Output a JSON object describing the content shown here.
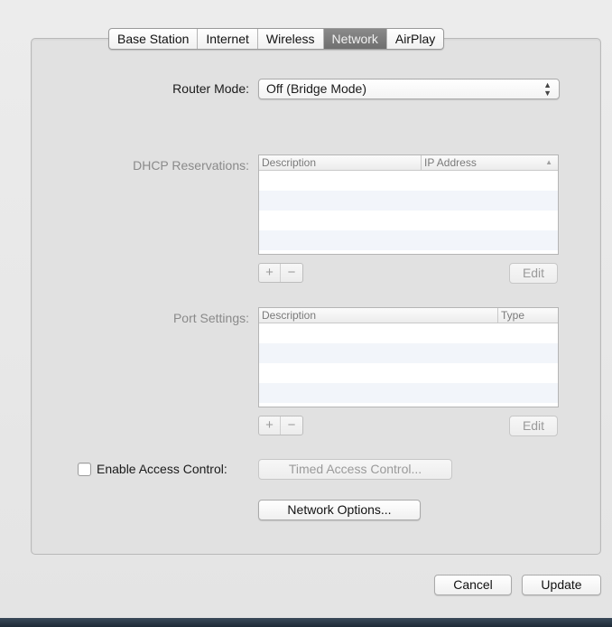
{
  "tabs": [
    {
      "label": "Base Station",
      "selected": false
    },
    {
      "label": "Internet",
      "selected": false
    },
    {
      "label": "Wireless",
      "selected": false
    },
    {
      "label": "Network",
      "selected": true
    },
    {
      "label": "AirPlay",
      "selected": false
    }
  ],
  "router_mode": {
    "label": "Router Mode:",
    "value": "Off (Bridge Mode)"
  },
  "dhcp": {
    "label": "DHCP Reservations:",
    "columns": [
      "Description",
      "IP Address"
    ],
    "add_label": "+",
    "remove_label": "−",
    "edit_label": "Edit"
  },
  "ports": {
    "label": "Port Settings:",
    "columns": [
      "Description",
      "Type"
    ],
    "add_label": "+",
    "remove_label": "−",
    "edit_label": "Edit"
  },
  "access_control": {
    "label": "Enable Access Control:",
    "checked": false,
    "timed_button": "Timed Access Control..."
  },
  "network_options_button": "Network Options...",
  "footer": {
    "cancel_label": "Cancel",
    "update_label": "Update"
  }
}
